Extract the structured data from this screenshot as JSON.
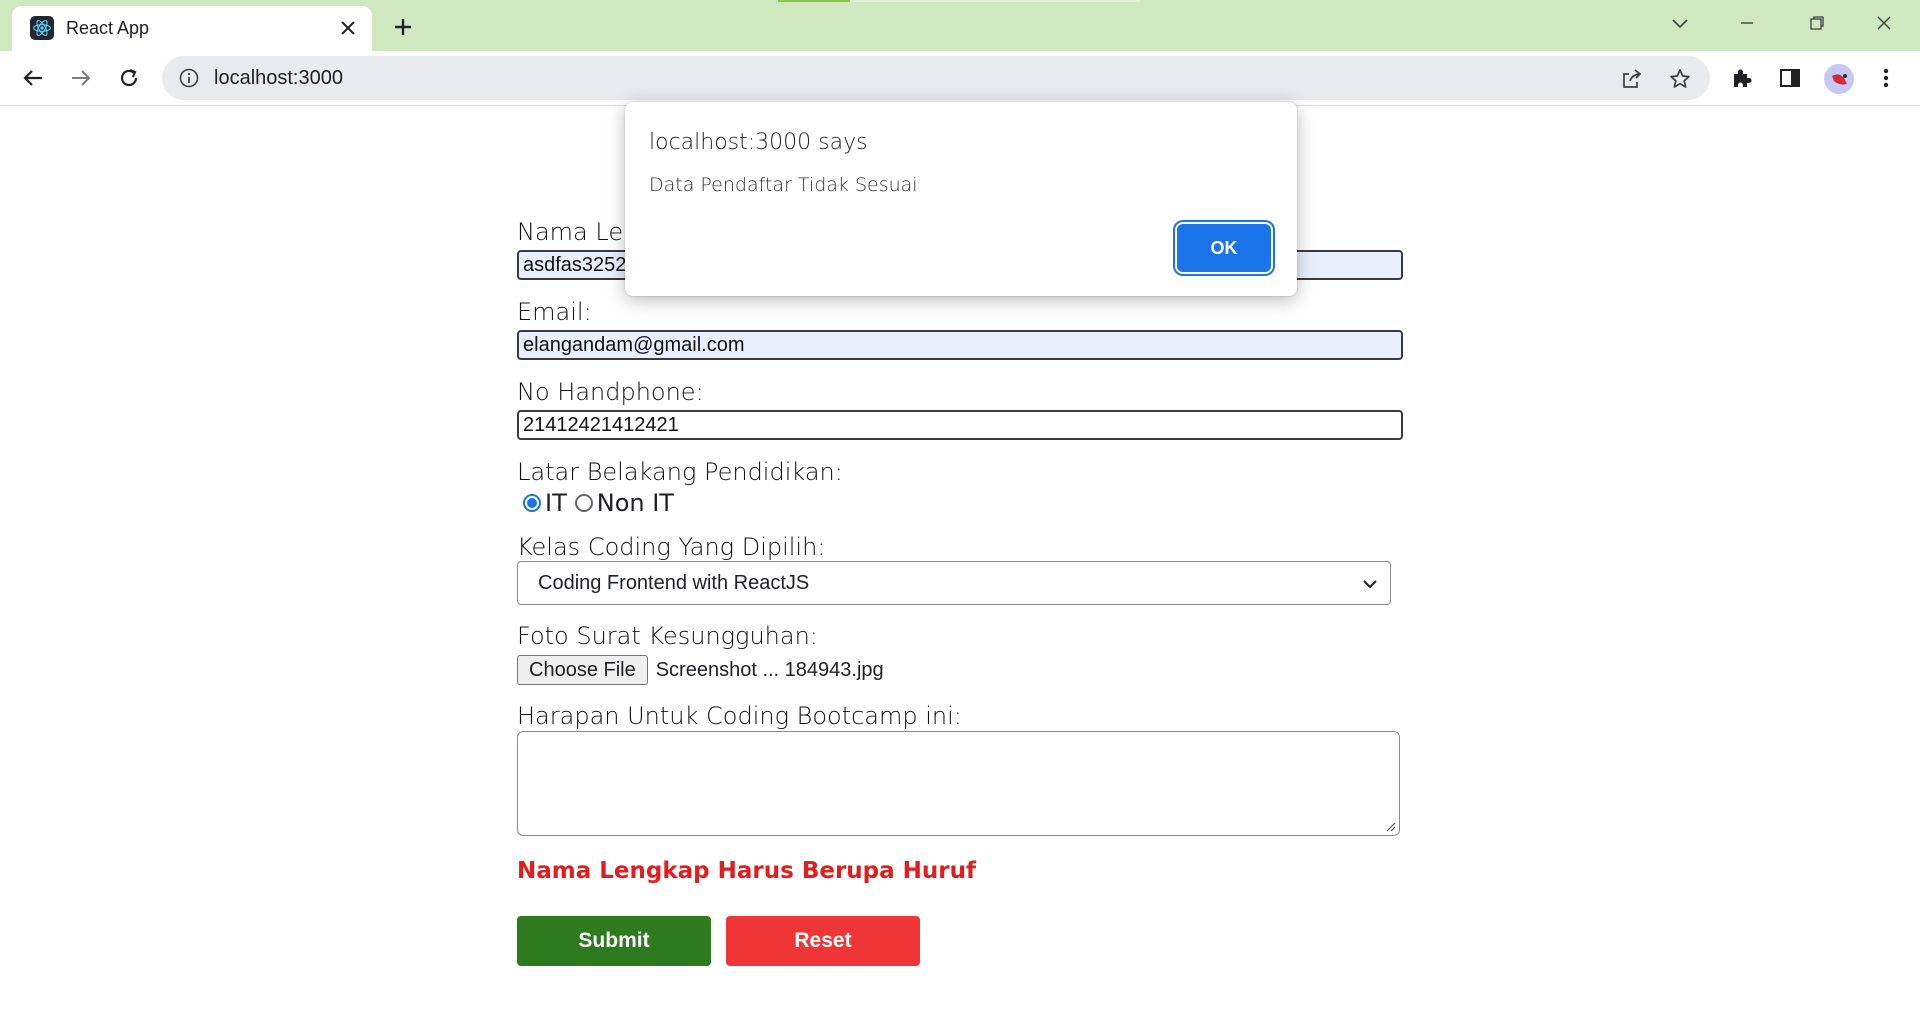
{
  "browser": {
    "tab_title": "React App",
    "url": "localhost:3000"
  },
  "form": {
    "nama": {
      "label": "Nama Len",
      "value": "asdfas3252"
    },
    "email": {
      "label": "Email:",
      "value": "elangandam@gmail.com"
    },
    "hp": {
      "label": "No Handphone:",
      "value": "21412421412421"
    },
    "pendidikan": {
      "label": "Latar Belakang Pendidikan:",
      "options": [
        "IT",
        "Non IT"
      ],
      "selected": "IT"
    },
    "kelas": {
      "label": "Kelas Coding Yang Dipilih:",
      "value": "Coding Frontend with ReactJS"
    },
    "foto": {
      "label": "Foto Surat Kesungguhan:",
      "button": "Choose File",
      "filename": "Screenshot ... 184943.jpg"
    },
    "harapan": {
      "label": "Harapan Untuk Coding Bootcamp ini:",
      "value": ""
    },
    "error": "Nama Lengkap Harus Berupa Huruf",
    "submit_label": "Submit",
    "reset_label": "Reset"
  },
  "dialog": {
    "title": "localhost:3000 says",
    "message": "Data Pendaftar Tidak Sesuai",
    "ok_label": "OK"
  },
  "colors": {
    "tabstrip": "#cfe8c0",
    "submit": "#2d7a1f",
    "reset": "#ef3535",
    "error": "#e11d1d",
    "ok_button": "#1a73e8"
  }
}
